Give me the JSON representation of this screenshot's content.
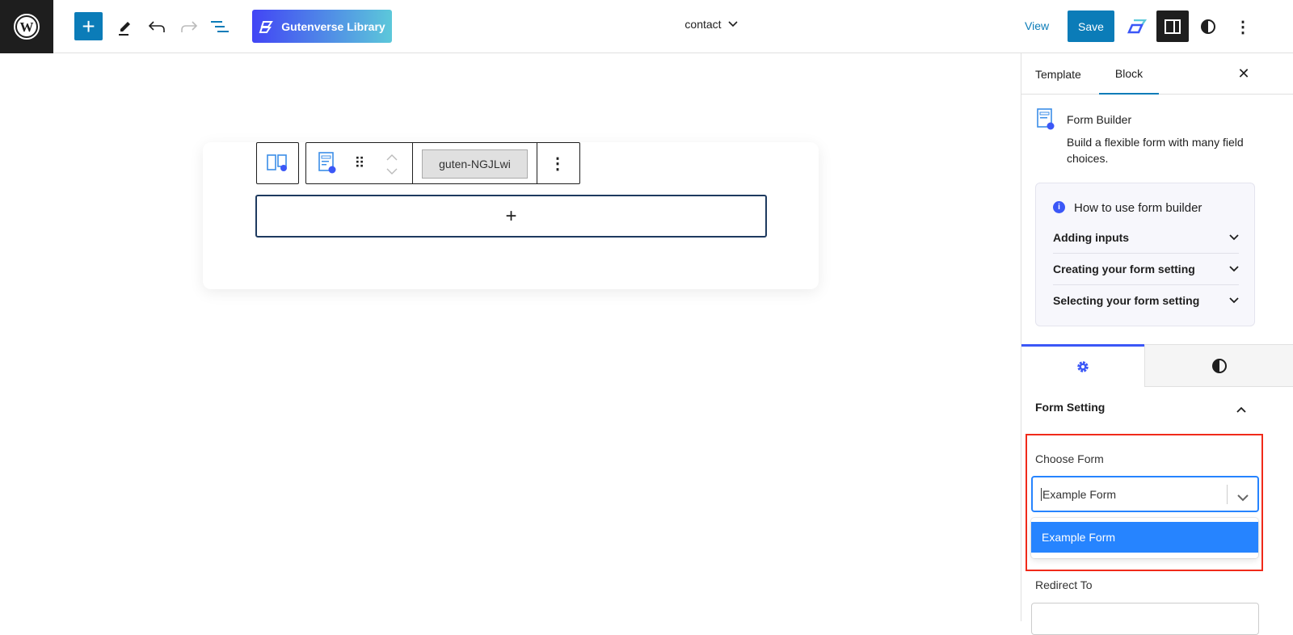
{
  "topbar": {
    "library_label": "Gutenverse Library",
    "doc_title": "contact",
    "view_label": "View",
    "save_label": "Save"
  },
  "block_toolbar": {
    "anchor": "guten-NGJLwi"
  },
  "sidebar": {
    "tabs": [
      "Template",
      "Block"
    ],
    "block_name": "Form Builder",
    "block_desc": "Build a flexible form with many field choices.",
    "howto": {
      "title": "How to use form builder",
      "items": [
        "Adding inputs",
        "Creating your form setting",
        "Selecting your form setting"
      ]
    },
    "section_title": "Form Setting",
    "choose_form_label": "Choose Form",
    "choose_form_value": "Example Form",
    "options": [
      "Example Form"
    ],
    "redirect_label": "Redirect To"
  },
  "colors": {
    "accent": "#0b7cb8",
    "gv_blue": "#3b57f7",
    "highlight": "#f02a1a",
    "option": "#2684ff"
  }
}
